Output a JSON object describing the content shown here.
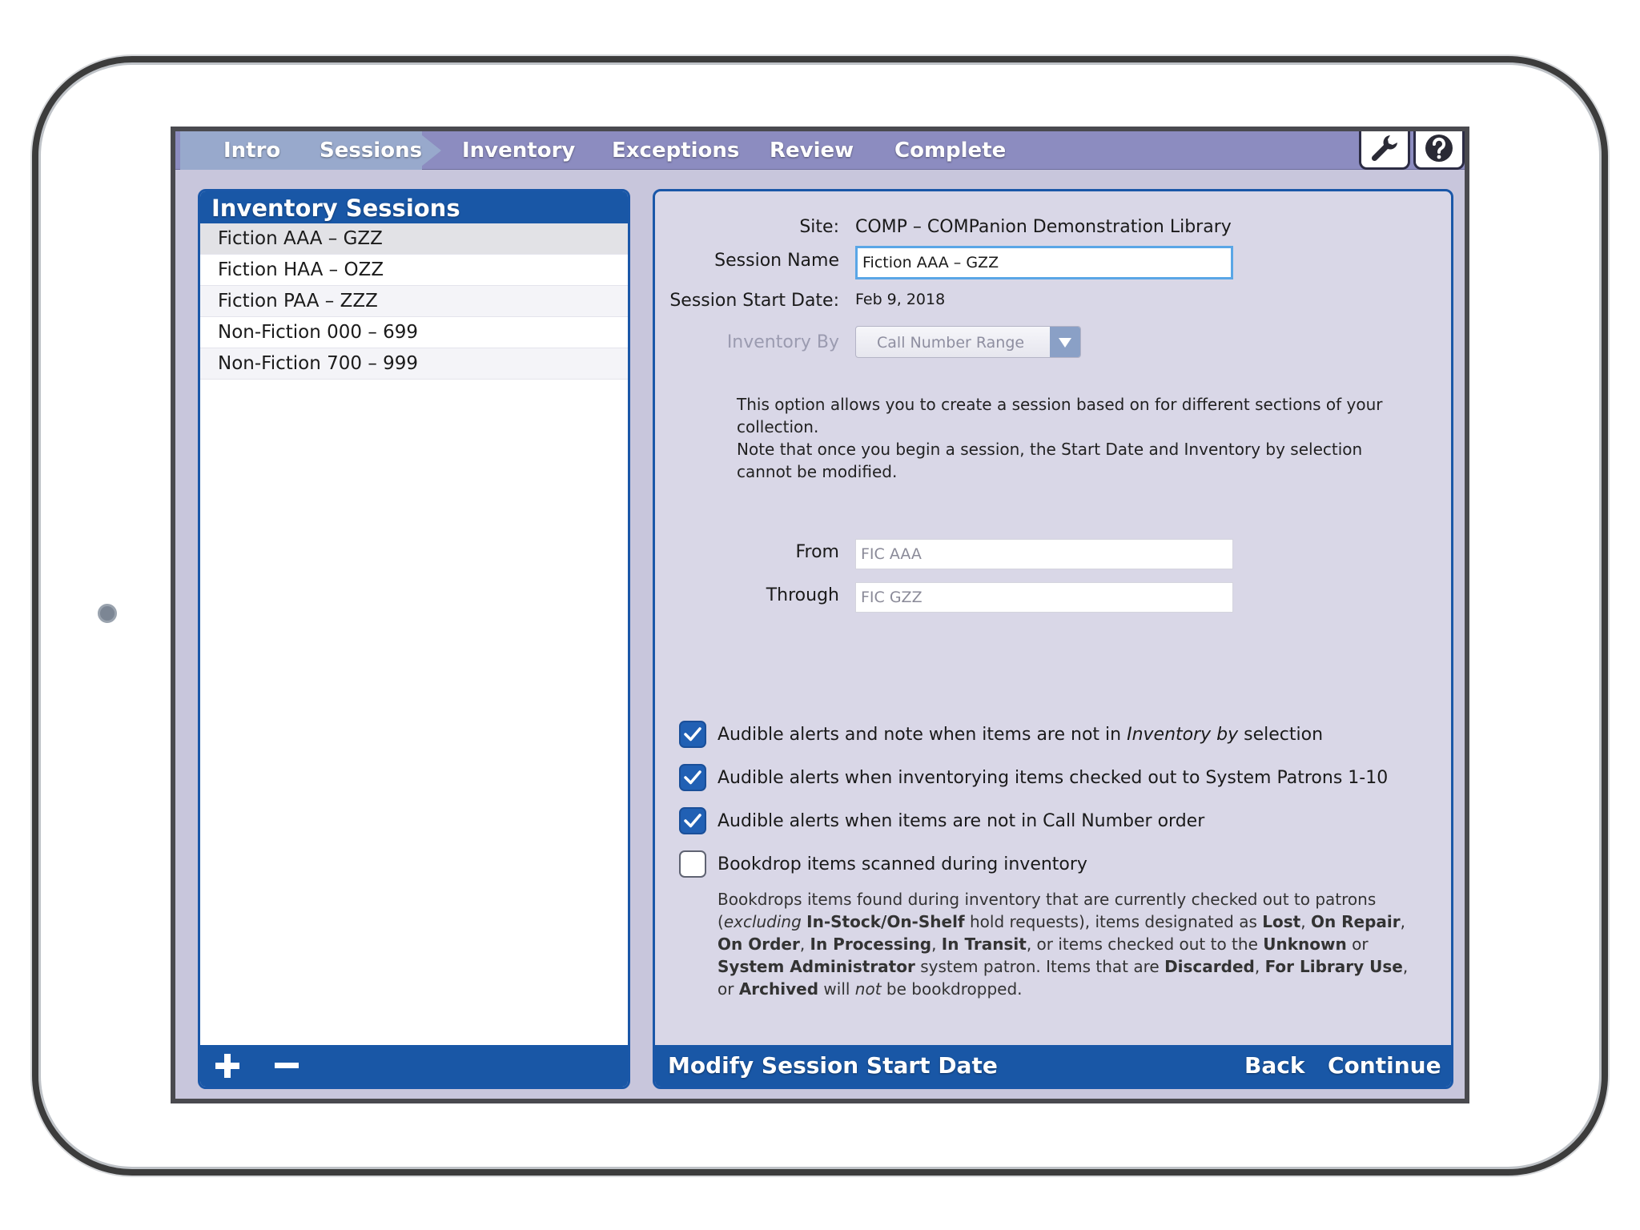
{
  "nav": {
    "tabs": [
      {
        "label": "Intro"
      },
      {
        "label": "Sessions"
      },
      {
        "label": "Inventory"
      },
      {
        "label": "Exceptions"
      },
      {
        "label": "Review"
      },
      {
        "label": "Complete"
      }
    ],
    "active_index": 1
  },
  "toolbar": {
    "tools_icon": "wrench-icon",
    "help_icon": "question-circle-icon"
  },
  "sessions": {
    "title": "Inventory Sessions",
    "items": [
      {
        "label": "Fiction AAA – GZZ",
        "selected": true
      },
      {
        "label": "Fiction HAA – OZZ"
      },
      {
        "label": "Fiction PAA – ZZZ"
      },
      {
        "label": "Non-Fiction 000 – 699"
      },
      {
        "label": "Non-Fiction 700 – 999"
      }
    ],
    "add_icon": "plus-icon",
    "remove_icon": "minus-icon"
  },
  "form": {
    "site_label": "Site:",
    "site_value": "COMP – COMPanion Demonstration Library",
    "session_name_label": "Session Name",
    "session_name_value": "Fiction AAA – GZZ",
    "start_date_label": "Session Start Date:",
    "start_date_value": "Feb 9, 2018",
    "inventory_by_label": "Inventory By",
    "inventory_by_value": "Call Number Range",
    "help_line1": "This option allows you to create a session based on for different sections of your collection.",
    "help_line2": "Note that once you begin a session, the Start Date and Inventory by selection cannot be modified.",
    "from_label": "From",
    "from_value": "FIC AAA",
    "through_label": "Through",
    "through_value": "FIC GZZ"
  },
  "options": {
    "opt1_before": "Audible alerts and note when items are not in ",
    "opt1_em": "Inventory by",
    "opt1_after": " selection",
    "opt1_checked": true,
    "opt2": "Audible alerts when inventorying items checked out to System Patrons 1-10",
    "opt2_checked": true,
    "opt3": "Audible alerts when items are not in Call Number order",
    "opt3_checked": true,
    "opt4": "Bookdrop items scanned during inventory",
    "opt4_checked": false
  },
  "bookdrop_note": {
    "t1": "Bookdrops items found during inventory that are currently checked out to patrons (",
    "e1": "excluding",
    "t2": " ",
    "b1": "In-Stock/On-Shelf",
    "t3": " hold requests), items designated as ",
    "b2": "Lost",
    "t4": ", ",
    "b3": "On Repair",
    "t5": ", ",
    "b4": "On Order",
    "t6": ", ",
    "b5": "In Processing",
    "t7": ", ",
    "b6": "In Transit",
    "t8": ", or items checked out to the ",
    "b7": "Unknown",
    "t9": " or ",
    "b8": "System Administrator",
    "t10": " system patron. Items that are ",
    "b9": "Discarded",
    "t11": ", ",
    "b10": "For Library Use",
    "t12": ", or ",
    "b11": "Archived",
    "t13": " will ",
    "e2": "not",
    "t14": " be bookdropped."
  },
  "footer": {
    "modify_label": "Modify Session Start Date",
    "back_label": "Back",
    "continue_label": "Continue"
  },
  "colors": {
    "accent_blue": "#1957a6",
    "nav_bar": "#8c8cc0",
    "nav_done": "#98a9cc",
    "panel_bg": "#d9d7e7"
  }
}
